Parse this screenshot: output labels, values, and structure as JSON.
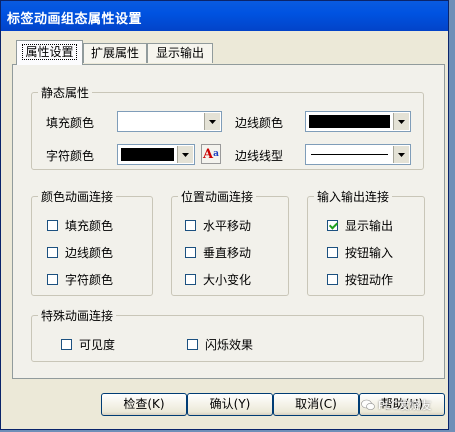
{
  "window": {
    "title": "标签动画组态属性设置"
  },
  "tabs": [
    {
      "label": "属性设置",
      "active": true
    },
    {
      "label": "扩展属性",
      "active": false
    },
    {
      "label": "显示输出",
      "active": false
    }
  ],
  "static_props": {
    "legend": "静态属性",
    "fill_color_label": "填充颜色",
    "fill_color_value": "#ffffff",
    "border_color_label": "边线颜色",
    "border_color_value": "#000000",
    "char_color_label": "字符颜色",
    "char_color_value": "#000000",
    "border_style_label": "边线线型",
    "font_button_glyph_a": "A",
    "font_button_glyph_b": "a"
  },
  "color_anim": {
    "legend": "颜色动画连接",
    "items": [
      {
        "label": "填充颜色",
        "checked": false
      },
      {
        "label": "边线颜色",
        "checked": false
      },
      {
        "label": "字符颜色",
        "checked": false
      }
    ]
  },
  "pos_anim": {
    "legend": "位置动画连接",
    "items": [
      {
        "label": "水平移动",
        "checked": false
      },
      {
        "label": "垂直移动",
        "checked": false
      },
      {
        "label": "大小变化",
        "checked": false
      }
    ]
  },
  "io_conn": {
    "legend": "输入输出连接",
    "items": [
      {
        "label": "显示输出",
        "checked": true
      },
      {
        "label": "按钮输入",
        "checked": false
      },
      {
        "label": "按钮动作",
        "checked": false
      }
    ]
  },
  "special_anim": {
    "legend": "特殊动画连接",
    "items": [
      {
        "label": "可见度",
        "checked": false
      },
      {
        "label": "闪烁效果",
        "checked": false
      }
    ]
  },
  "buttons": {
    "check": "检查(K)",
    "confirm": "确认(Y)",
    "cancel": "取消(C)",
    "help": "帮助(H)"
  },
  "watermark": {
    "text": "PLC发烧友"
  }
}
